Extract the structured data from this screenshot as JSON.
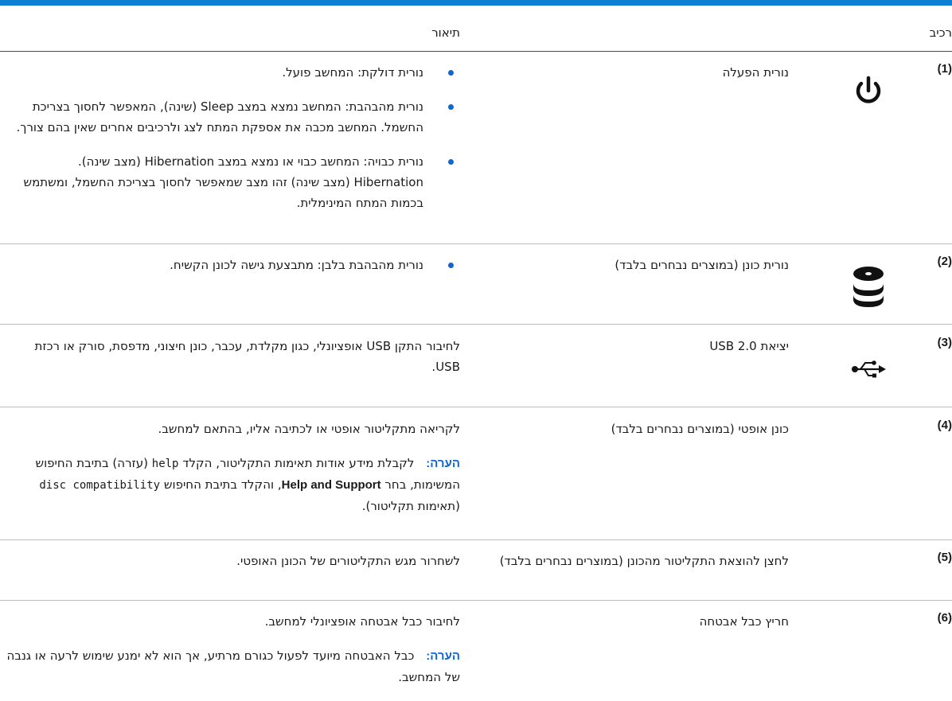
{
  "header": {
    "col_component": "רכיב",
    "col_description": "תיאור"
  },
  "rows": [
    {
      "num": "(1)",
      "icon": "power-icon",
      "component": "נורית הפעלה",
      "bullets": [
        "נורית דולקת: המחשב פועל.",
        "נורית מהבהבת: המחשב נמצא במצב Sleep (שינה), המאפשר לחסוך בצריכת החשמל. המחשב מכבה את אספקת המתח לצג ולרכיבים אחרים שאין בהם צורך.",
        "נורית כבויה: המחשב כבוי או נמצא במצב Hibernation (מצב שינה). Hibernation (מצב שינה) זהו מצב שמאפשר לחסוך בצריכת החשמל, ומשתמש בכמות המתח המינימלית."
      ]
    },
    {
      "num": "(2)",
      "icon": "drive-icon",
      "component": "נורית כונן (במוצרים נבחרים בלבד)",
      "bullets": [
        "נורית מהבהבת בלבן: מתבצעת גישה לכונן הקשיח."
      ]
    },
    {
      "num": "(3)",
      "icon": "usb-icon",
      "component": "יציאת USB 2.0",
      "text": "לחיבור התקן USB אופציונלי, כגון מקלדת, עכבר, כונן חיצוני, מדפסת, סורק או רכזת USB."
    },
    {
      "num": "(4)",
      "component": "כונן אופטי (במוצרים נבחרים בלבד)",
      "text": "לקריאה מתקליטור אופטי או לכתיבה אליו, בהתאם למחשב.",
      "note": {
        "label": "הערה:",
        "t1": "לקבלת מידע אודות תאימות התקליטור, הקלד",
        "code1": "help",
        "t2": "(עזרה) בתיבת החיפוש המשימות, בחר",
        "bold": "Help and Support",
        "t3": ", והקלד בתיבת החיפוש",
        "code2": "disc compatibility",
        "t4": "(תאימות תקליטור)."
      }
    },
    {
      "num": "(5)",
      "component": "לחצן להוצאת התקליטור מהכונן (במוצרים נבחרים בלבד)",
      "text": "לשחרור מגש התקליטורים של הכונן האופטי."
    },
    {
      "num": "(6)",
      "component": "חריץ כבל אבטחה",
      "text": "לחיבור כבל אבטחה אופציונלי למחשב.",
      "note": {
        "label": "הערה:",
        "t1": "כבל האבטחה מיועד לפעול כגורם מרתיע, אך הוא לא ימנע שימוש לרעה או גנבה של המחשב."
      }
    }
  ]
}
